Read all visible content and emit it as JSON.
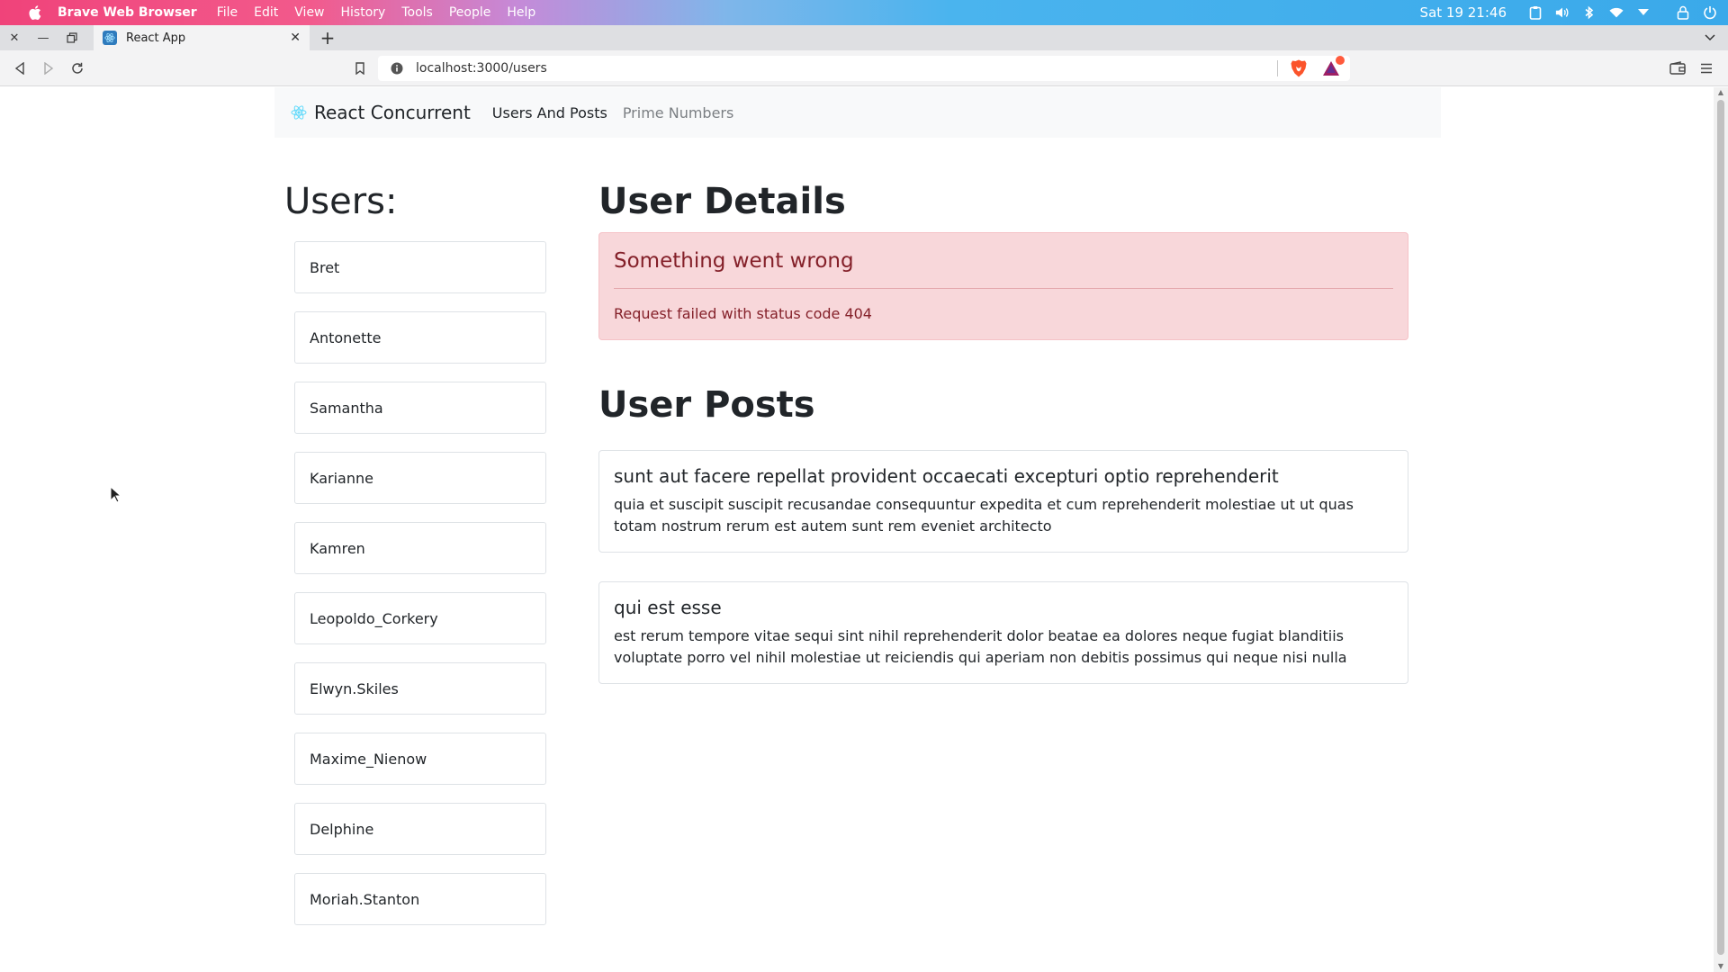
{
  "os": {
    "app_name": "Brave Web Browser",
    "menu": [
      "File",
      "Edit",
      "View",
      "History",
      "Tools",
      "People",
      "Help"
    ],
    "clock": "Sat 19 21:46"
  },
  "browser": {
    "tab_title": "React App",
    "url": "localhost:3000/users",
    "rewards_badge_color": "#ff5a3c"
  },
  "app": {
    "brand": "React Concurrent",
    "nav": [
      {
        "label": "Users And Posts",
        "active": true
      },
      {
        "label": "Prime Numbers",
        "active": false
      }
    ],
    "users_title": "Users:",
    "users": [
      "Bret",
      "Antonette",
      "Samantha",
      "Karianne",
      "Kamren",
      "Leopoldo_Corkery",
      "Elwyn.Skiles",
      "Maxime_Nienow",
      "Delphine",
      "Moriah.Stanton"
    ],
    "details_title": "User Details",
    "alert": {
      "heading": "Something went wrong",
      "message": "Request failed with status code 404"
    },
    "posts_title": "User Posts",
    "posts": [
      {
        "title": "sunt aut facere repellat provident occaecati excepturi optio reprehenderit",
        "body": "quia et suscipit suscipit recusandae consequuntur expedita et cum reprehenderit molestiae ut ut quas totam nostrum rerum est autem sunt rem eveniet architecto"
      },
      {
        "title": "qui est esse",
        "body": "est rerum tempore vitae sequi sint nihil reprehenderit dolor beatae ea dolores neque fugiat blanditiis voluptate porro vel nihil molestiae ut reiciendis qui aperiam non debitis possimus qui neque nisi nulla"
      }
    ]
  }
}
